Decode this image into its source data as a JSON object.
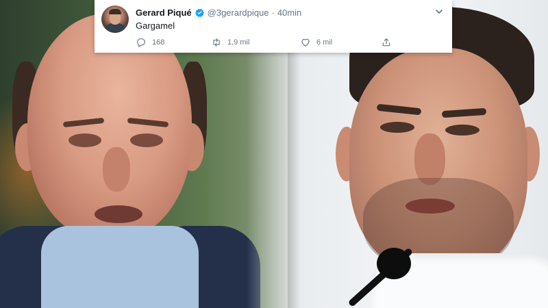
{
  "tweet": {
    "display_name": "Gerard Piqué",
    "handle": "@3gerardpique",
    "separator": "·",
    "time": "40min",
    "text": "Gargamel",
    "reply_count": "168",
    "retweet_count": "1,9 mil",
    "like_count": "6 mil",
    "verified_icon": "verified-badge-icon",
    "menu_icon": "chevron-down-icon"
  },
  "colors": {
    "verified": "#1da1f2",
    "secondary_text": "#657786",
    "primary_text": "#14171a",
    "card_background": "#ffffff"
  }
}
